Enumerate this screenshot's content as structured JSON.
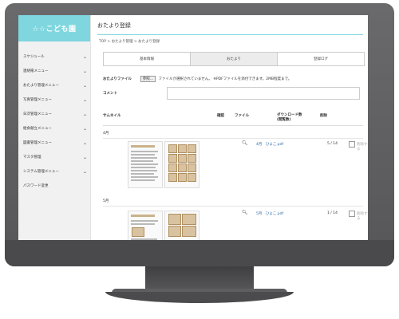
{
  "app": {
    "logo": "☆☆こども園"
  },
  "sidebar": {
    "items": [
      {
        "label": "スケジュール",
        "chevron": true
      },
      {
        "label": "連絡帳メニュー",
        "chevron": true
      },
      {
        "label": "おたより管理メニュー",
        "chevron": true
      },
      {
        "label": "写真管理メニュー",
        "chevron": true
      },
      {
        "label": "日次管理メニュー",
        "chevron": true
      },
      {
        "label": "給食献立メニュー",
        "chevron": true
      },
      {
        "label": "図書管理メニュー",
        "chevron": true
      },
      {
        "label": "マスタ管理",
        "chevron": true
      },
      {
        "label": "システム管理メニュー",
        "chevron": true
      },
      {
        "label": "パスワード変更",
        "chevron": false
      }
    ]
  },
  "page": {
    "title": "おたより登録",
    "breadcrumb": "TOP > おたより管理 > おたより登録"
  },
  "tabs": [
    {
      "label": "基本情報",
      "active": false
    },
    {
      "label": "おたより",
      "active": true
    },
    {
      "label": "登録ログ",
      "active": false
    }
  ],
  "form": {
    "file_label": "おたよりファイル",
    "browse_label": "参照...",
    "file_status": "ファイルが選択されていません。 ※PDFファイルを添付できます。2MB程度まで。",
    "comment_label": "コメント"
  },
  "table": {
    "headers": {
      "thumbnail": "サムネイル",
      "confirm": "確認",
      "file": "ファイル",
      "downloads": "ダウンロード数\n(閲覧数)",
      "delete": "削除"
    },
    "rows": [
      {
        "month": "4月",
        "file": "4月　ひよこ.pdf",
        "downloads": "5 / 14",
        "delete": "削除する"
      },
      {
        "month": "5月",
        "file": "5月　ひよこ.pdf",
        "downloads": "1 / 14",
        "delete": "削除する"
      }
    ]
  }
}
